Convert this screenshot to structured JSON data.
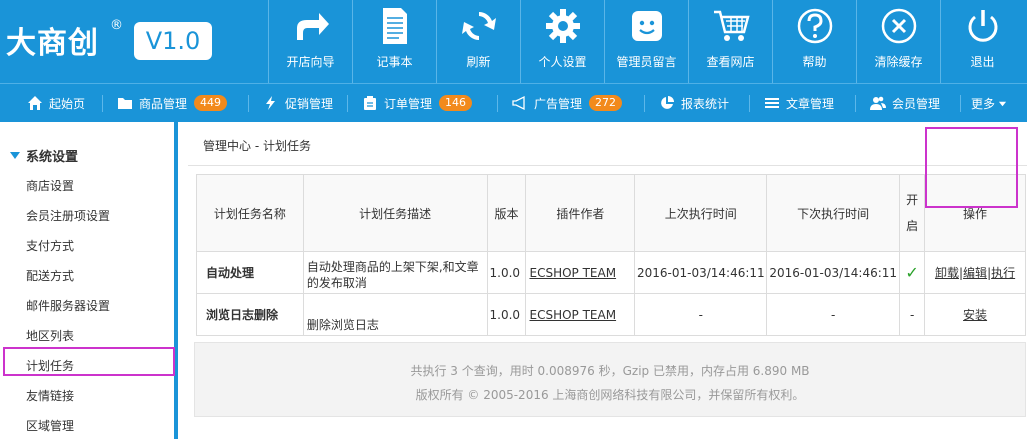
{
  "brand": {
    "name": "大商创",
    "reg": "®",
    "version": "V1.0"
  },
  "toolbar": [
    {
      "label": "开店向导",
      "icon": "share-arrow-icon"
    },
    {
      "label": "记事本",
      "icon": "notepad-icon"
    },
    {
      "label": "刷新",
      "icon": "refresh-icon"
    },
    {
      "label": "个人设置",
      "icon": "gear-icon"
    },
    {
      "label": "管理员留言",
      "icon": "smiley-icon"
    },
    {
      "label": "查看网店",
      "icon": "cart-icon"
    },
    {
      "label": "帮助",
      "icon": "help-icon"
    },
    {
      "label": "清除缓存",
      "icon": "close-circle-icon"
    },
    {
      "label": "退出",
      "icon": "power-icon"
    }
  ],
  "nav": [
    {
      "label": "起始页",
      "icon": "home-icon"
    },
    {
      "label": "商品管理",
      "icon": "folder-icon",
      "badge": "449"
    },
    {
      "label": "促销管理",
      "icon": "lightning-icon"
    },
    {
      "label": "订单管理",
      "icon": "clipboard-icon",
      "badge": "146"
    },
    {
      "label": "广告管理",
      "icon": "megaphone-icon",
      "badge": "272"
    },
    {
      "label": "报表统计",
      "icon": "pie-chart-icon"
    },
    {
      "label": "文章管理",
      "icon": "list-icon"
    },
    {
      "label": "会员管理",
      "icon": "users-icon"
    },
    {
      "label": "更多",
      "icon": "caret-down-icon"
    }
  ],
  "sidebar": {
    "title": "系统设置",
    "items": [
      "商店设置",
      "会员注册项设置",
      "支付方式",
      "配送方式",
      "邮件服务器设置",
      "地区列表",
      "计划任务",
      "友情链接",
      "区域管理"
    ],
    "active": "计划任务"
  },
  "breadcrumb": {
    "root": "管理中心",
    "sep": " - ",
    "current": "计划任务"
  },
  "table": {
    "headers": [
      "计划任务名称",
      "计划任务描述",
      "版本",
      "插件作者",
      "上次执行时间",
      "下次执行时间",
      "开启",
      "操作"
    ],
    "rows": [
      {
        "name": "自动处理",
        "description": "自动处理商品的上架下架,和文章的发布取消",
        "version": "1.0.0",
        "author": "ECSHOP TEAM",
        "last_run": "2016-01-03/14:46:11",
        "next_run": "2016-01-03/14:46:11",
        "enabled": "✓",
        "actions": [
          "卸载",
          "编辑",
          "执行"
        ],
        "action_sep": "|"
      },
      {
        "name": "浏览日志删除",
        "description": "删除浏览日志",
        "version": "1.0.0",
        "author": "ECSHOP TEAM",
        "last_run": "-",
        "next_run": "-",
        "enabled": "-",
        "actions": [
          "安装"
        ]
      }
    ]
  },
  "footer": {
    "line1": "共执行 3 个查询，用时 0.008976 秒，Gzip 已禁用，内存占用 6.890 MB",
    "line2": "版权所有 © 2005-2016 上海商创网络科技有限公司，并保留所有权利。"
  },
  "colors": {
    "brand_blue": "#1a94d8",
    "badge_orange": "#f28a1c",
    "highlight_magenta": "#cc33cc",
    "check_green": "#2aa12a"
  }
}
